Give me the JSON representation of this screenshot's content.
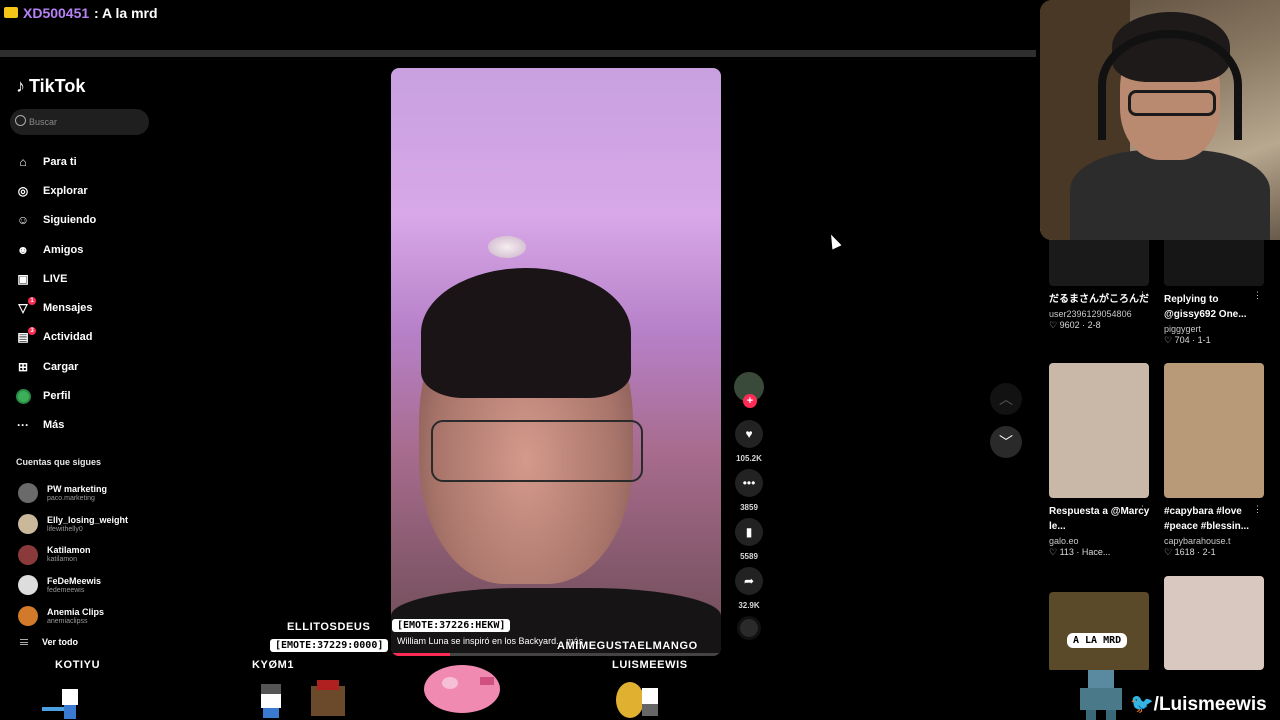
{
  "chat": {
    "username": "XD500451",
    "message": ": A la mrd"
  },
  "tiktok": {
    "brand": "TikTok",
    "search_placeholder": "Buscar",
    "nav": [
      {
        "label": "Para ti",
        "icon": "home-icon"
      },
      {
        "label": "Explorar",
        "icon": "compass-icon"
      },
      {
        "label": "Siguiendo",
        "icon": "following-icon"
      },
      {
        "label": "Amigos",
        "icon": "friends-icon"
      },
      {
        "label": "LIVE",
        "icon": "live-icon"
      },
      {
        "label": "Mensajes",
        "icon": "messages-icon",
        "badge": "1"
      },
      {
        "label": "Actividad",
        "icon": "activity-icon",
        "badge": "3"
      },
      {
        "label": "Cargar",
        "icon": "upload-icon"
      },
      {
        "label": "Perfil",
        "icon": "profile-avatar"
      },
      {
        "label": "Más",
        "icon": "more-icon"
      }
    ],
    "following_title": "Cuentas que sigues",
    "following": [
      {
        "name": "PW marketing",
        "user": "paco.marketing",
        "color": "#6a6a6a"
      },
      {
        "name": "Elly_losing_weight",
        "user": "lifewithelly0",
        "color": "#c9b89a"
      },
      {
        "name": "Katilamon",
        "user": "katilamon",
        "color": "#8a3a3a"
      },
      {
        "name": "FeDeMeewis",
        "user": "fedemeewis",
        "color": "#dddddd"
      },
      {
        "name": "Anemia Clips",
        "user": "anemiaclipss",
        "color": "#d07a2a"
      }
    ],
    "see_all": "Ver todo",
    "video": {
      "caption": "William Luna se inspiró en los Backyard... más"
    },
    "actions": [
      {
        "icon": "heart-icon",
        "count": "105.2K"
      },
      {
        "icon": "comment-icon",
        "count": "3859"
      },
      {
        "icon": "bookmark-icon",
        "count": "5589"
      },
      {
        "icon": "share-icon",
        "count": "32.9K"
      }
    ]
  },
  "feed": [
    {
      "title": "だるまさんがころんだ",
      "user": "user2396129054806",
      "stats": "♡ 9602 · 2-8",
      "thumb": "#1a1a1a"
    },
    {
      "title": "Replying to @gissy692 One...",
      "user": "piggygert",
      "stats": "♡ 704 · 1-1",
      "thumb": "#161616"
    },
    {
      "title": "Respuesta a @Marcy le...",
      "user": "galo.eo",
      "stats": "♡ 113 · Hace...",
      "thumb": "#c9b8a8"
    },
    {
      "title": "#capybara #love #peace #blessin...",
      "user": "capybarahouse.t",
      "stats": "♡ 1618 · 2-1",
      "thumb": "#b89a78"
    },
    {
      "title": "",
      "user": "",
      "stats": "",
      "thumb": "#5a4a2a"
    },
    {
      "title": "",
      "user": "",
      "stats": "",
      "thumb": "#d8c8c0"
    }
  ],
  "overlay": {
    "names": [
      "ELLITOSDEUS",
      "KOTIYU",
      "KYØM1",
      "AMIMEGUSTAELMANGO",
      "LUISMEEWIS"
    ],
    "emotes": [
      "[EMOTE:37226:HEKW]",
      "[EMOTE:37229:0000]"
    ],
    "bubble": "A LA MRD",
    "twitter_handle": "/Luismeewis"
  },
  "colors": {
    "accent": "#fe2c55",
    "username": "#b682f5"
  }
}
